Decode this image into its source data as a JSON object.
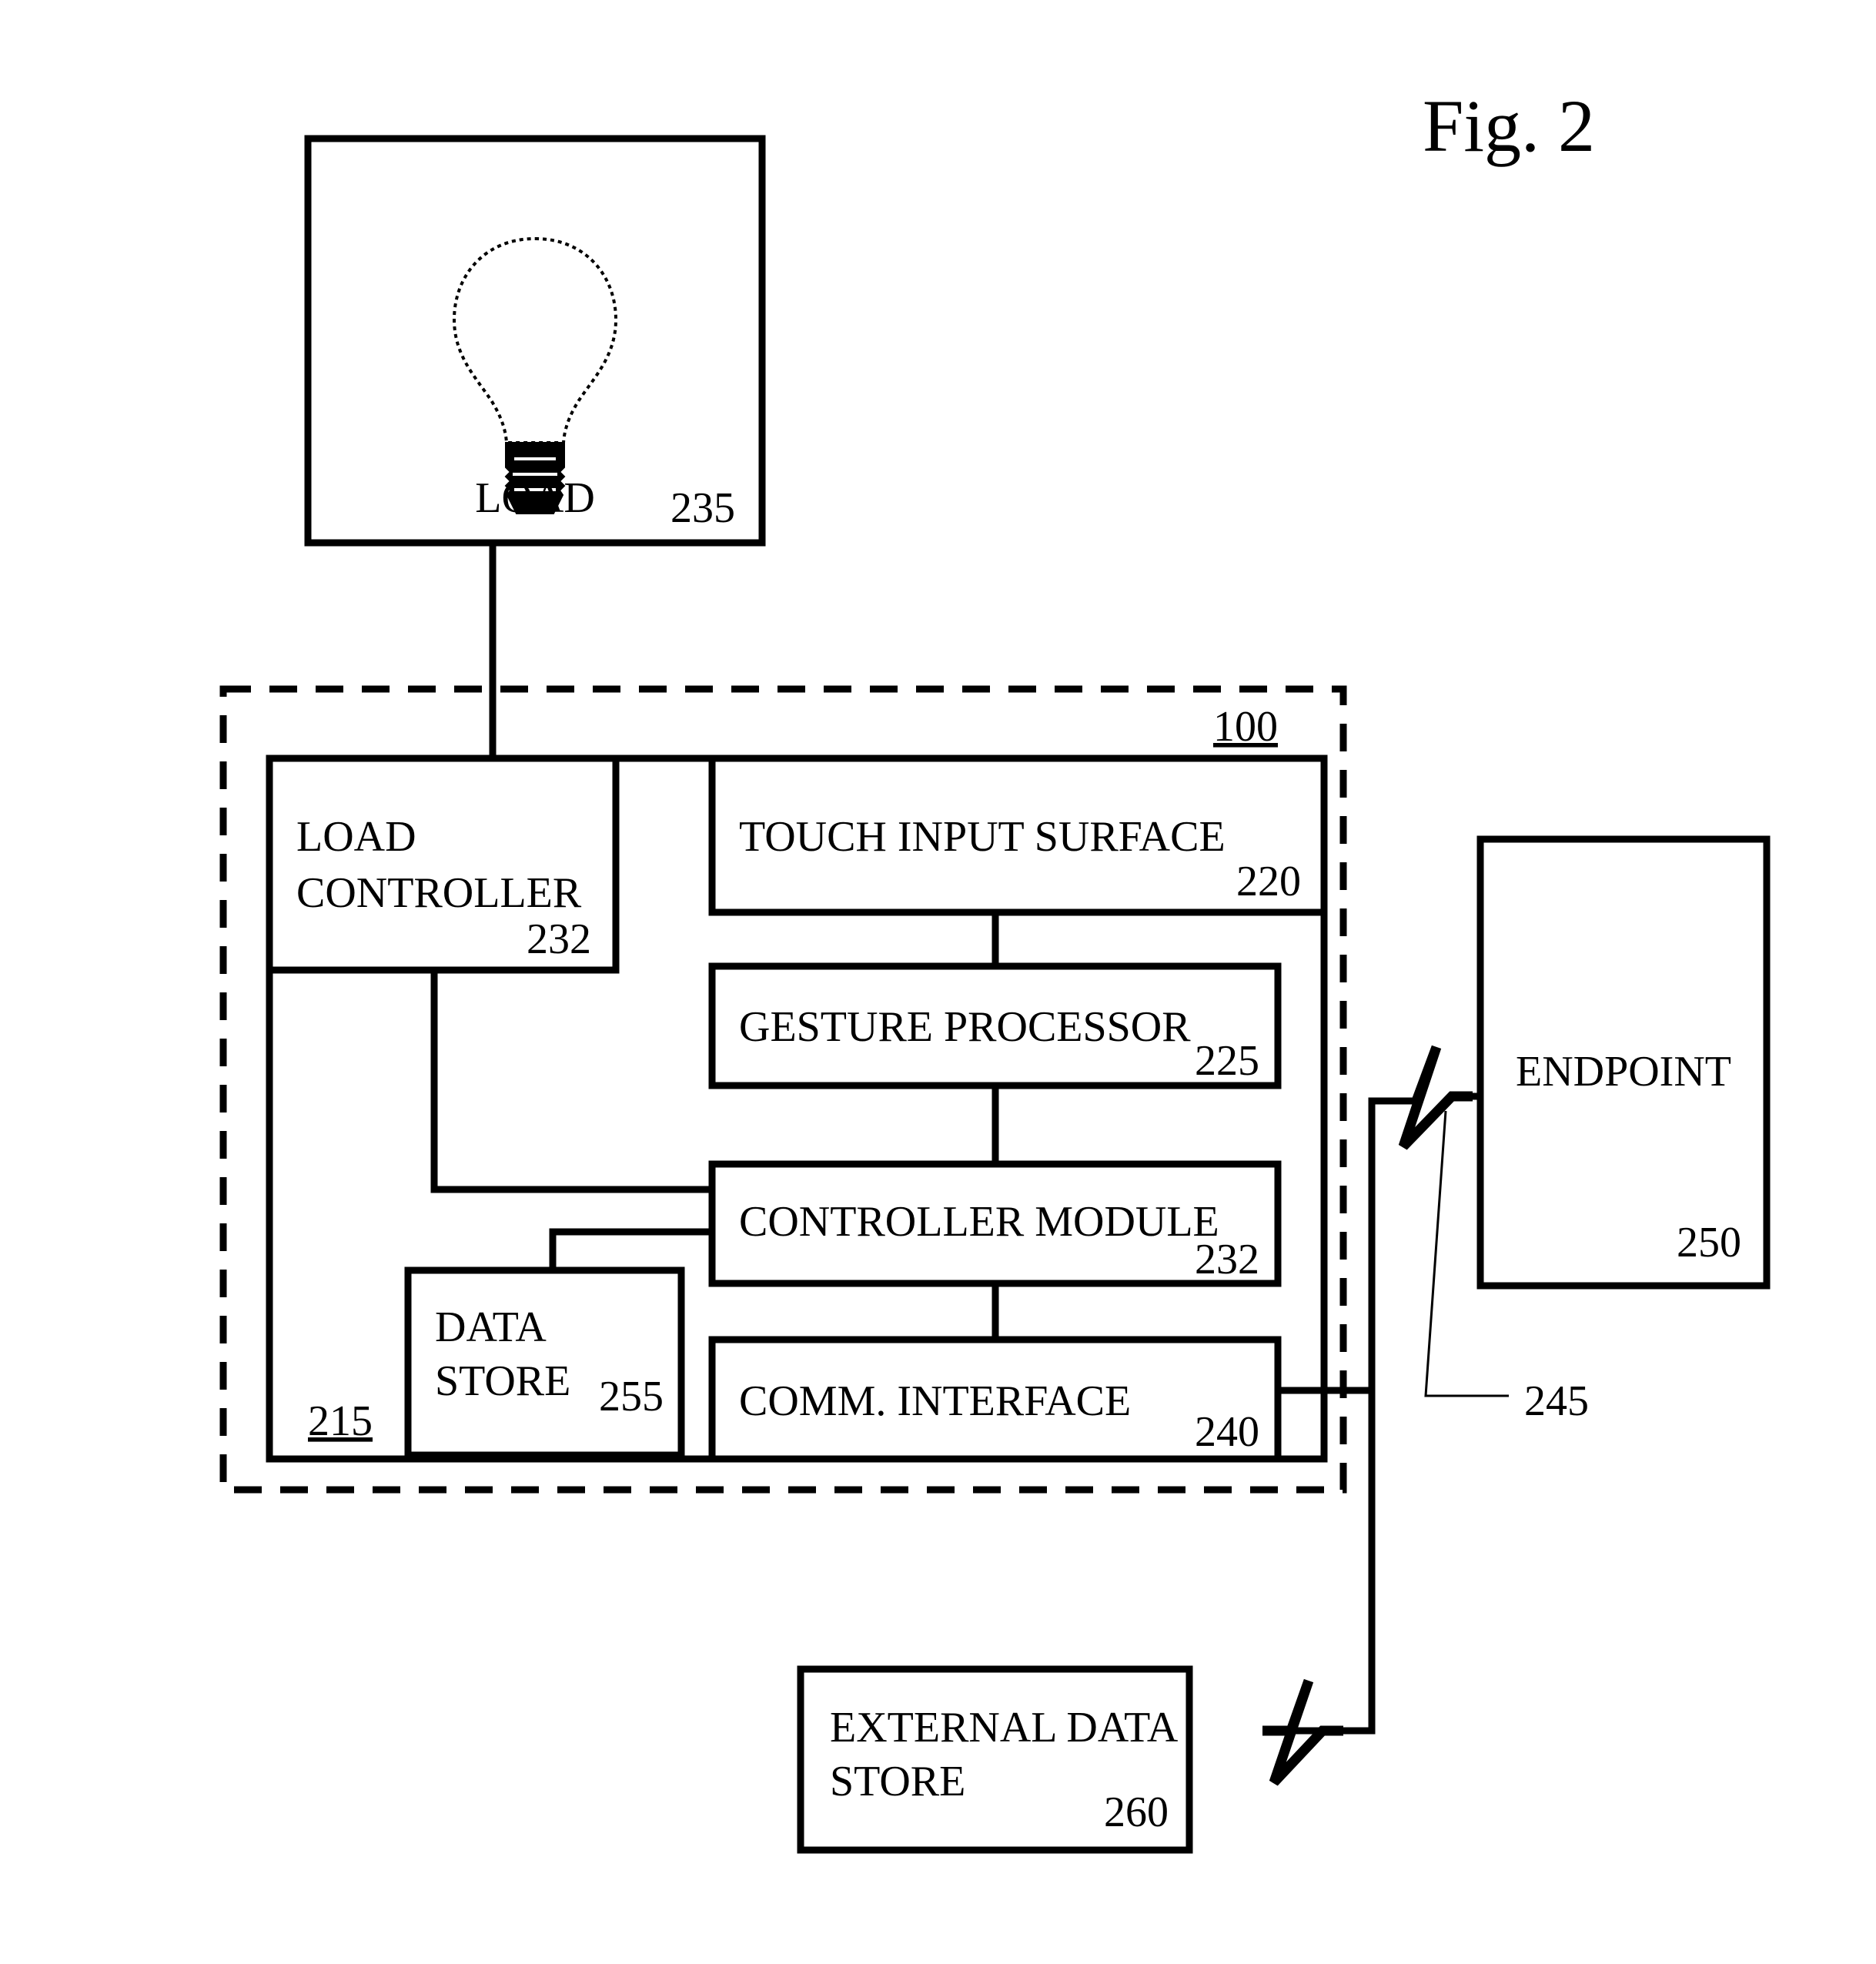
{
  "figure": {
    "title": "Fig. 2"
  },
  "blocks": {
    "load": {
      "label": "LOAD",
      "number": "235",
      "icon": "light-bulb-icon"
    },
    "system": {
      "number": "100"
    },
    "device": {
      "number": "215"
    },
    "load_controller": {
      "label_line1": "LOAD",
      "label_line2": "CONTROLLER",
      "number": "232"
    },
    "touch_input_surface": {
      "label": "TOUCH INPUT SURFACE",
      "number": "220"
    },
    "gesture_processor": {
      "label": "GESTURE PROCESSOR",
      "number": "225"
    },
    "controller_module": {
      "label": "CONTROLLER MODULE",
      "number": "232"
    },
    "data_store": {
      "label_line1": "DATA",
      "label_line2": "STORE",
      "number": "255"
    },
    "comm_interface": {
      "label": "COMM. INTERFACE",
      "number": "240"
    },
    "endpoint": {
      "label": "ENDPOINT",
      "number": "250"
    },
    "external_data_store": {
      "label_line1": "EXTERNAL DATA",
      "label_line2": "STORE",
      "number": "260"
    },
    "network_link": {
      "number": "245"
    }
  },
  "colors": {
    "stroke": "#000000",
    "background": "#ffffff"
  }
}
